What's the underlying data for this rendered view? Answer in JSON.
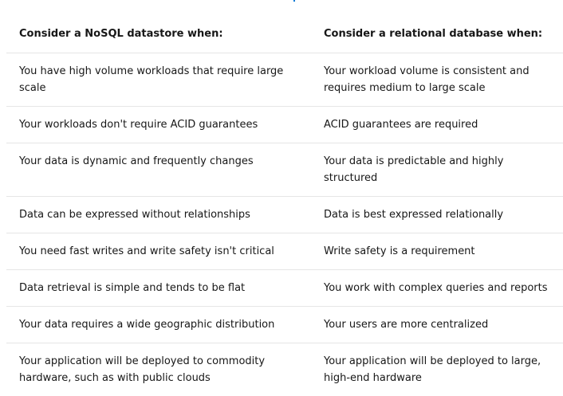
{
  "table": {
    "headers": [
      "Consider a NoSQL datastore when:",
      "Consider a relational database when:"
    ],
    "rows": [
      [
        "You have high volume workloads that require large scale",
        "Your workload volume is consistent and requires medium to large scale"
      ],
      [
        "Your workloads don't require ACID guarantees",
        "ACID guarantees are required"
      ],
      [
        "Your data is dynamic and frequently changes",
        "Your data is predictable and highly structured"
      ],
      [
        "Data can be expressed without relationships",
        "Data is best expressed relationally"
      ],
      [
        "You need fast writes and write safety isn't critical",
        "Write safety is a requirement"
      ],
      [
        "Data retrieval is simple and tends to be flat",
        "You work with complex queries and reports"
      ],
      [
        "Your data requires a wide geographic distribution",
        "Your users are more centralized"
      ],
      [
        "Your application will be deployed to commodity hardware, such as with public clouds",
        "Your application will be deployed to large, high-end hardware"
      ]
    ]
  }
}
